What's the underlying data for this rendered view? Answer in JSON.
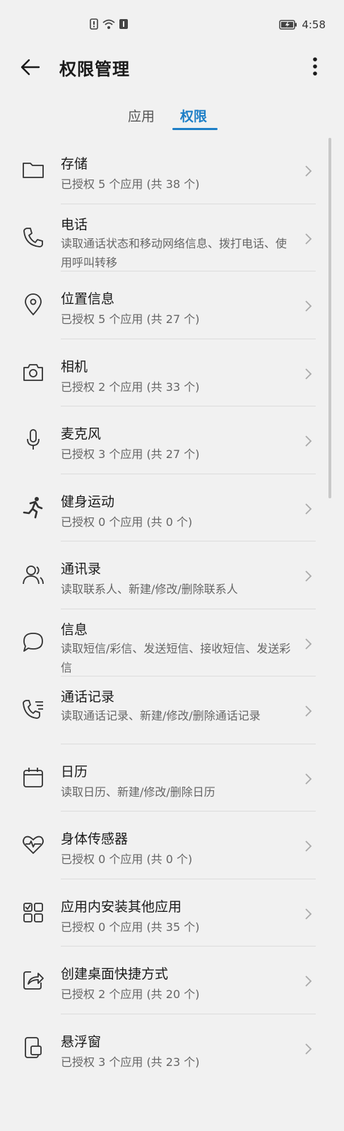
{
  "status_bar": {
    "time": "4:58"
  },
  "header": {
    "title": "权限管理"
  },
  "tabs": [
    {
      "label": "应用",
      "active": false
    },
    {
      "label": "权限",
      "active": true
    }
  ],
  "colors": {
    "accent": "#1e7fc7",
    "background": "#f1f1f1",
    "text_secondary": "#666666"
  },
  "items": [
    {
      "title": "存储",
      "subtitle": "已授权 5 个应用 (共 38 个)",
      "icon": "folder-icon"
    },
    {
      "title": "电话",
      "subtitle": "读取通话状态和移动网络信息、拨打电话、使用呼叫转移",
      "icon": "phone-icon"
    },
    {
      "title": "位置信息",
      "subtitle": "已授权 5 个应用 (共 27 个)",
      "icon": "location-pin-icon"
    },
    {
      "title": "相机",
      "subtitle": "已授权 2 个应用 (共 33 个)",
      "icon": "camera-icon"
    },
    {
      "title": "麦克风",
      "subtitle": "已授权 3 个应用 (共 27 个)",
      "icon": "microphone-icon"
    },
    {
      "title": "健身运动",
      "subtitle": "已授权 0 个应用 (共 0 个)",
      "icon": "running-person-icon"
    },
    {
      "title": "通讯录",
      "subtitle": "读取联系人、新建/修改/删除联系人",
      "icon": "contacts-icon"
    },
    {
      "title": "信息",
      "subtitle": "读取短信/彩信、发送短信、接收短信、发送彩信",
      "icon": "message-bubble-icon"
    },
    {
      "title": "通话记录",
      "subtitle": "读取通话记录、新建/修改/删除通话记录",
      "icon": "call-log-icon"
    },
    {
      "title": "日历",
      "subtitle": "读取日历、新建/修改/删除日历",
      "icon": "calendar-icon"
    },
    {
      "title": "身体传感器",
      "subtitle": "已授权 0 个应用 (共 0 个)",
      "icon": "heart-pulse-icon"
    },
    {
      "title": "应用内安装其他应用",
      "subtitle": "已授权 0 个应用 (共 35 个)",
      "icon": "app-grid-icon"
    },
    {
      "title": "创建桌面快捷方式",
      "subtitle": "已授权 2 个应用 (共 20 个)",
      "icon": "shortcut-share-icon"
    },
    {
      "title": "悬浮窗",
      "subtitle": "已授权 3 个应用 (共 23 个)",
      "icon": "floating-window-icon"
    }
  ]
}
